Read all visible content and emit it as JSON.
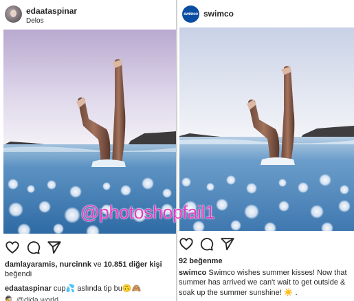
{
  "left_post": {
    "username": "edaataspinar",
    "location": "Delos",
    "likes_users": "damlayaramis, nurcinnk",
    "likes_joiner": " ve ",
    "likes_count": "10.851 diğer kişi",
    "likes_suffix": "beğendi",
    "caption_user": "edaataspinar",
    "caption_text": " cup💦 aslında tip bu🙃🙈",
    "comment_text": "🕵 @dida.world"
  },
  "right_post": {
    "username": "swimco",
    "avatar_text": "swimco",
    "likes": "92 beğenme",
    "caption_user": "swimco",
    "caption_line1": " Swimco wishes summer kisses! Now that",
    "caption_line2": "summer has arrived we can't wait to get outside &",
    "caption_line3": "soak up the summer sunshine! ☀️ ."
  },
  "watermark": "@photoshopfail1",
  "icons": [
    "heart-icon",
    "comment-icon",
    "share-icon"
  ],
  "colors": {
    "watermark": "#e240c2",
    "sky_left_top": "#b9a9cf",
    "sky_right_top": "#cdd6ea",
    "water": "#4d85b8",
    "swimco_brand": "#0b4da2"
  }
}
